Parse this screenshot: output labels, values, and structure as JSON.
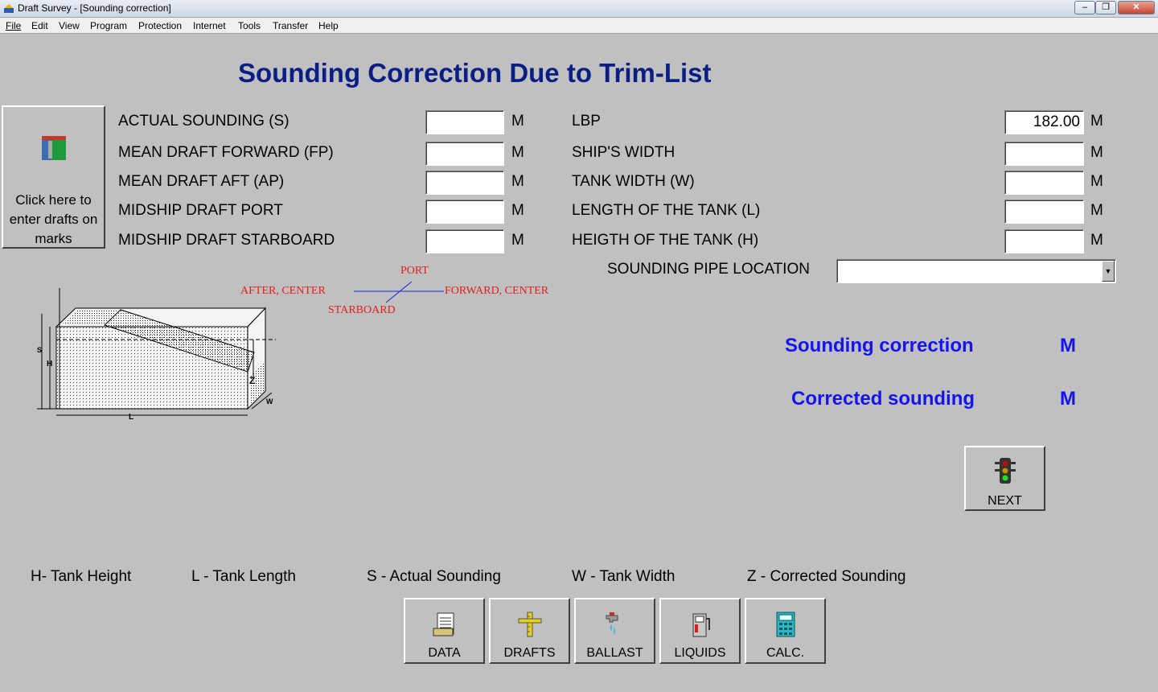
{
  "window": {
    "title": "Draft Survey - [Sounding correction]"
  },
  "menu": {
    "items": [
      "File",
      "Edit",
      "View",
      "Program",
      "Protection",
      "Internet",
      "Tools",
      "Transfer",
      "Help"
    ]
  },
  "page_title": "Sounding Correction Due to Trim-List",
  "drafts_button": {
    "label": "Click here to enter drafts on marks"
  },
  "left_fields": [
    {
      "label": "ACTUAL SOUNDING (S)",
      "value": "",
      "unit": "M"
    },
    {
      "label": "MEAN DRAFT FORWARD (FP)",
      "value": "",
      "unit": "M"
    },
    {
      "label": "MEAN DRAFT AFT (AP)",
      "value": "",
      "unit": "M"
    },
    {
      "label": "MIDSHIP DRAFT PORT",
      "value": "",
      "unit": "M"
    },
    {
      "label": "MIDSHIP DRAFT STARBOARD",
      "value": "",
      "unit": "M"
    }
  ],
  "right_fields": [
    {
      "label": "LBP",
      "value": "182.00",
      "unit": "M"
    },
    {
      "label": "SHIP'S WIDTH",
      "value": "",
      "unit": "M"
    },
    {
      "label": "TANK WIDTH (W)",
      "value": "",
      "unit": "M"
    },
    {
      "label": "LENGTH OF THE TANK (L)",
      "value": "",
      "unit": "M"
    },
    {
      "label": "HEIGTH OF THE TANK (H)",
      "value": "",
      "unit": "M"
    }
  ],
  "pipe_location": {
    "label": "SOUNDING PIPE LOCATION",
    "selected": ""
  },
  "diagram": {
    "port": "PORT",
    "starboard": "STARBOARD",
    "after_center": "AFTER, CENTER",
    "forward_center": "FORWARD, CENTER",
    "s": "S",
    "h": "H",
    "l": "L",
    "z": "Z",
    "w": "W"
  },
  "results": {
    "correction_label": "Sounding correction",
    "correction_unit": "M",
    "corrected_label": "Corrected sounding",
    "corrected_unit": "M"
  },
  "next_button": {
    "label": "NEXT"
  },
  "legend": {
    "h": "H- Tank Height",
    "l": "L - Tank Length",
    "s": "S - Actual Sounding",
    "w": "W - Tank Width",
    "z": "Z - Corrected Sounding"
  },
  "toolbar": {
    "data": "DATA",
    "drafts": "DRAFTS",
    "ballast": "BALLAST",
    "liquids": "LIQUIDS",
    "calc": "CALC."
  },
  "colors": {
    "title": "#0b1e85",
    "result": "#1414ee",
    "diagram_text": "#e0201c",
    "background": "#c0c0c0"
  }
}
